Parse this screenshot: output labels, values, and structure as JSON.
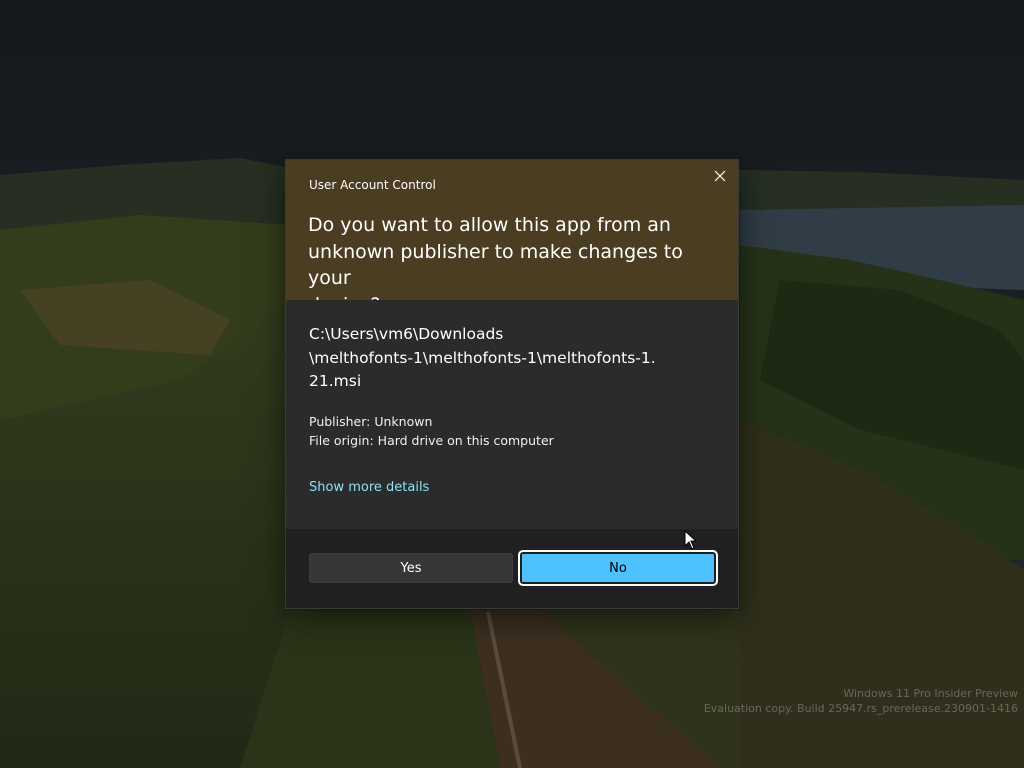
{
  "dialog": {
    "title": "User Account Control",
    "question_line1": "Do you want to allow this app from an",
    "question_line2": "unknown publisher to make changes to your",
    "question_line3": "device?",
    "path_line1": "C:\\Users\\vm6\\Downloads",
    "path_line2": "\\melthofonts-1\\melthofonts-1\\melthofonts-1.",
    "path_line3": "21.msi",
    "publisher": "Publisher: Unknown",
    "file_origin": "File origin: Hard drive on this computer",
    "show_more_label": "Show more details",
    "yes_label": "Yes",
    "no_label": "No",
    "close_icon": "close-icon",
    "colors": {
      "header_background": "#4a3d22",
      "body_background": "#2b2b2b",
      "footer_background": "#202020",
      "link": "#8ee0f4",
      "primary_button": "#4cc2ff",
      "secondary_button": "#373737"
    }
  },
  "watermark": {
    "line1": "Windows 11 Pro Insider Preview",
    "line2": "Evaluation copy. Build 25947.rs_prerelease.230901-1416"
  }
}
